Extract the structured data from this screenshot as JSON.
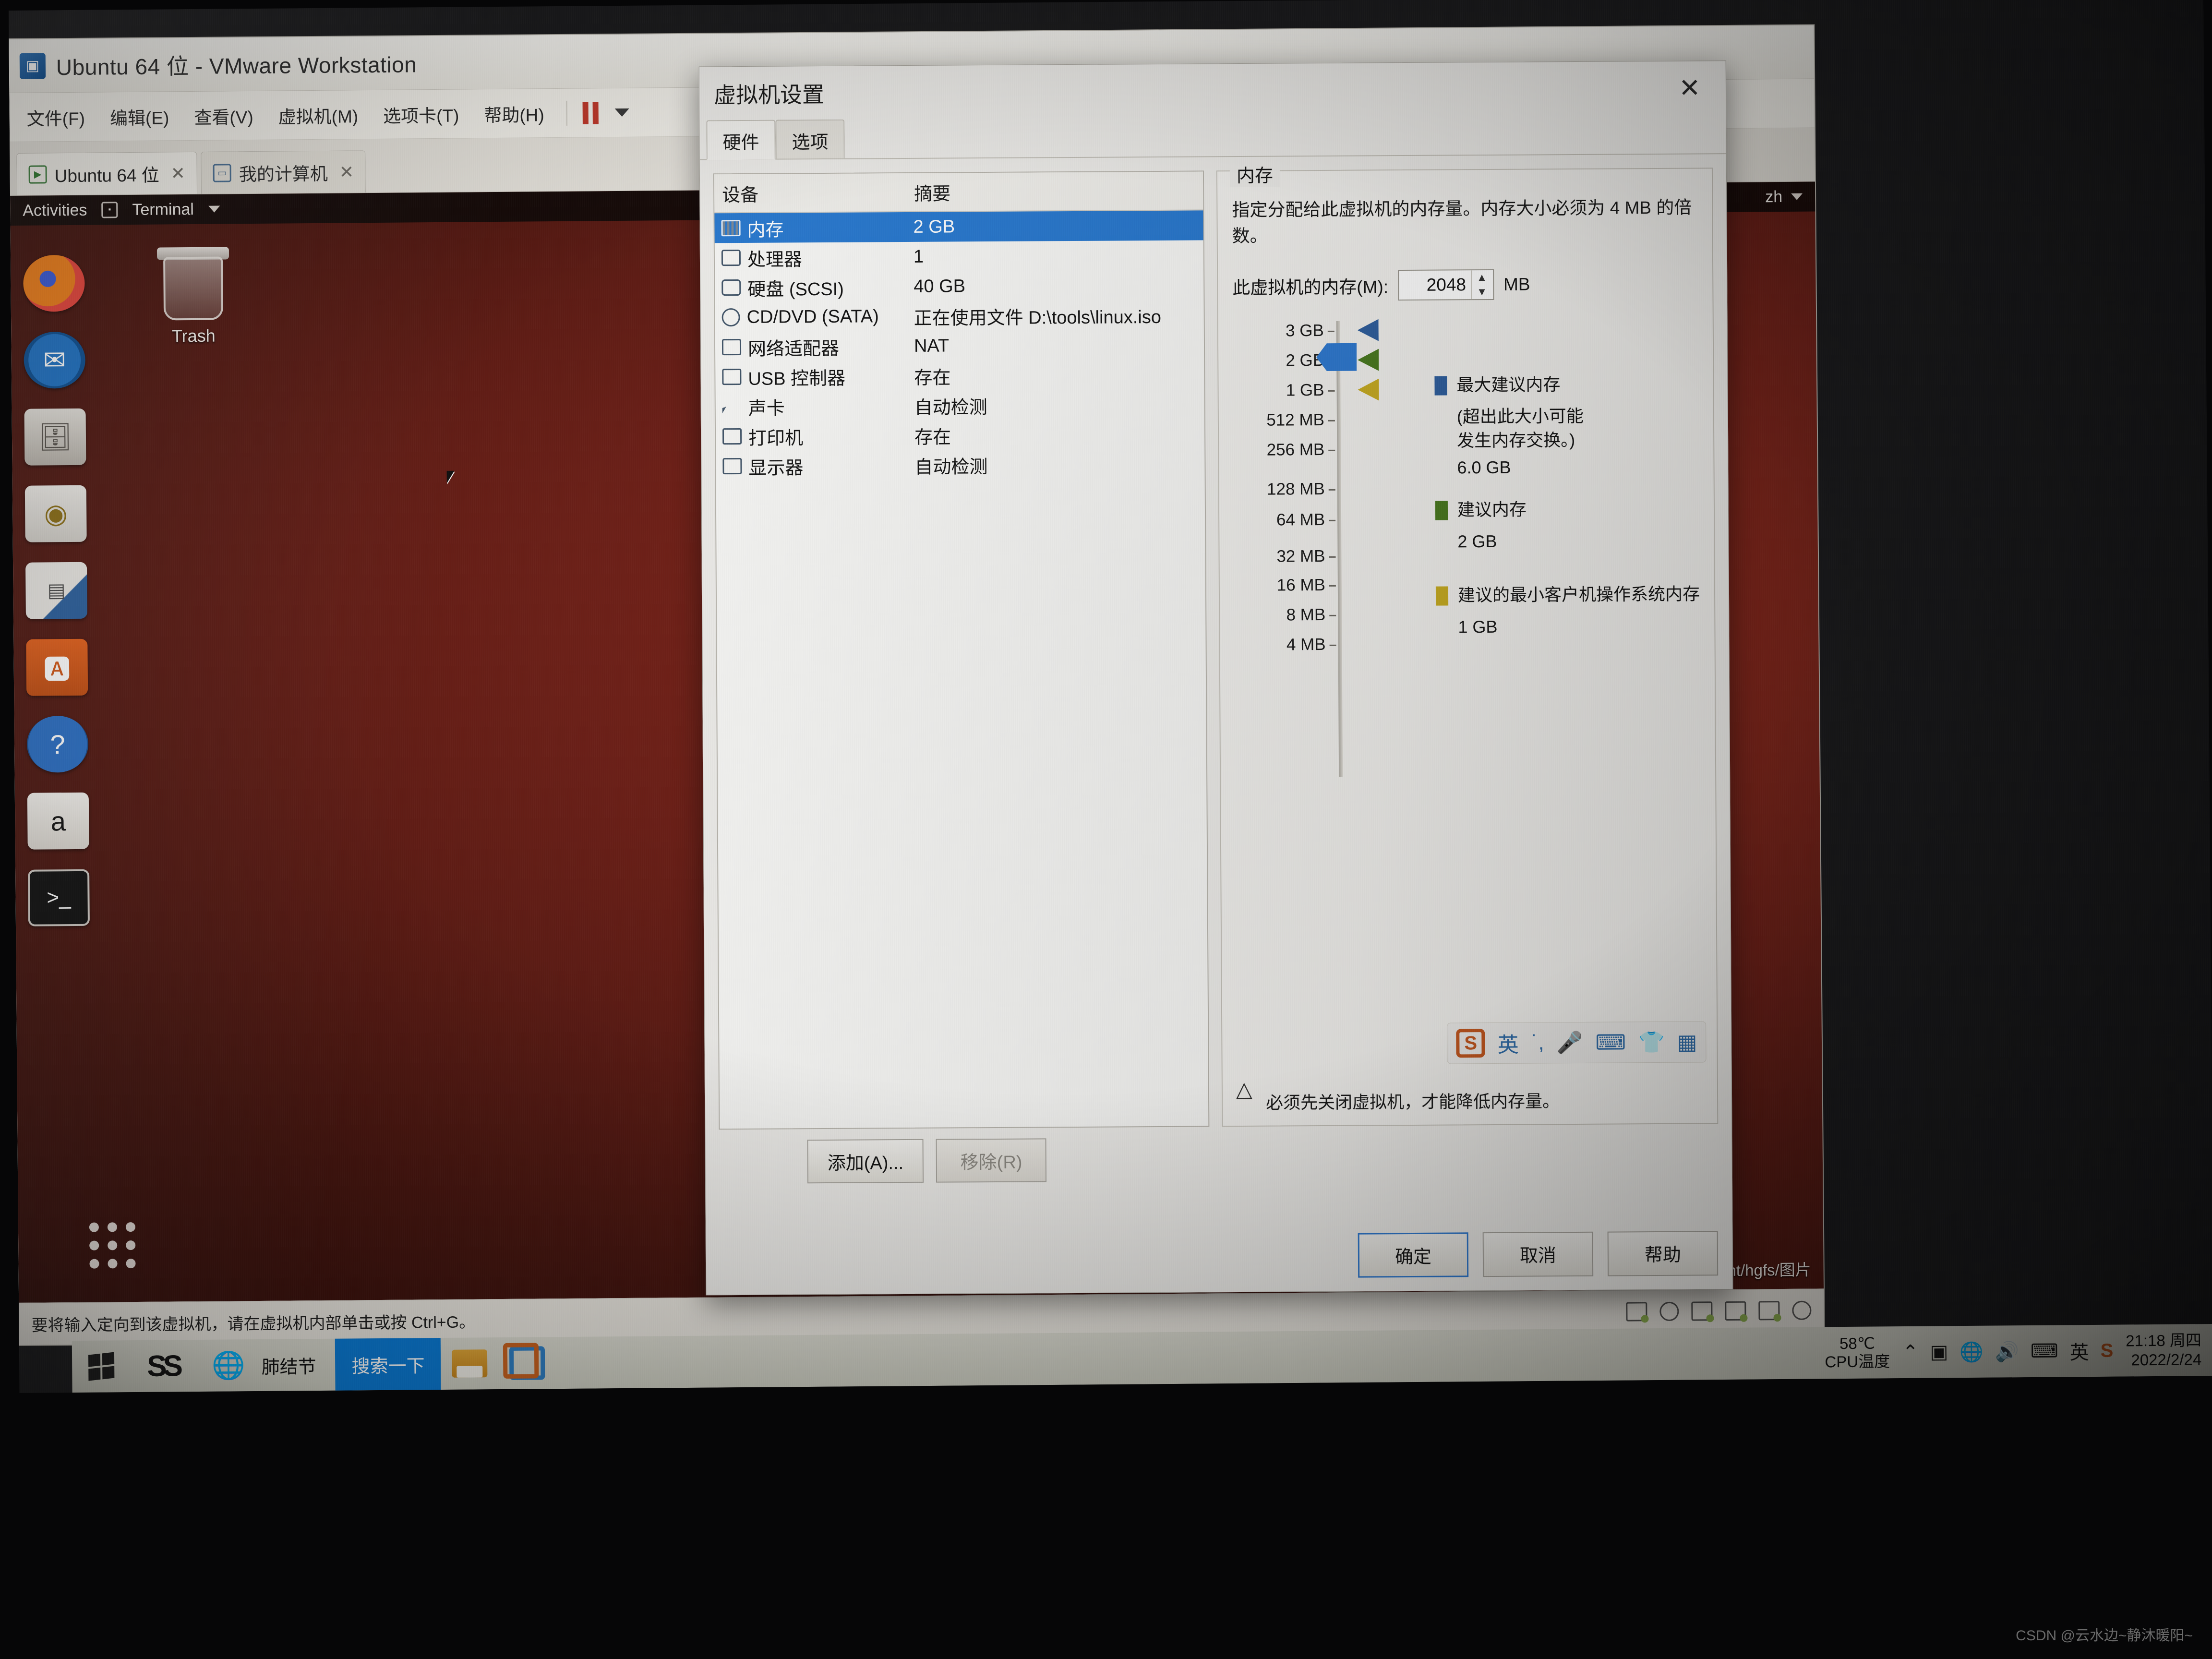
{
  "vmware": {
    "window_title": "Ubuntu 64 位 - VMware Workstation",
    "menu": [
      "文件(F)",
      "编辑(E)",
      "查看(V)",
      "虚拟机(M)",
      "选项卡(T)",
      "帮助(H)"
    ],
    "tabs": [
      {
        "label": "Ubuntu 64 位",
        "close": "✕"
      },
      {
        "label": "我的计算机",
        "close": "✕"
      }
    ],
    "status_text": "要将输入定向到该虚拟机，请在虚拟机内部单击或按 Ctrl+G。"
  },
  "guest": {
    "activities": "Activities",
    "app_menu": "Terminal",
    "lang": "zh",
    "desktop_icon": "Trash",
    "nautilus_path": "nux-virtual-machine: /mnt/hgfs/图片",
    "dock": [
      {
        "name": "firefox",
        "glyph": "🦊"
      },
      {
        "name": "thunderbird",
        "glyph": "✉"
      },
      {
        "name": "files",
        "glyph": "🗄"
      },
      {
        "name": "rhythmbox",
        "glyph": "◉"
      },
      {
        "name": "libreoffice-writer",
        "glyph": "📄"
      },
      {
        "name": "ubuntu-software",
        "glyph": "🅰"
      },
      {
        "name": "help",
        "glyph": "?"
      },
      {
        "name": "amazon",
        "glyph": "a"
      },
      {
        "name": "terminal",
        "glyph": ">_"
      }
    ]
  },
  "dialog": {
    "title": "虚拟机设置",
    "close": "✕",
    "tabs": [
      {
        "label": "硬件",
        "active": true
      },
      {
        "label": "选项",
        "active": false
      }
    ],
    "device_table": {
      "headers": [
        "设备",
        "摘要"
      ],
      "rows": [
        {
          "device": "内存",
          "summary": "2 GB",
          "icon": "memory-icon",
          "selected": true
        },
        {
          "device": "处理器",
          "summary": "1",
          "icon": "cpu-icon",
          "selected": false
        },
        {
          "device": "硬盘 (SCSI)",
          "summary": "40 GB",
          "icon": "harddisk-icon",
          "selected": false
        },
        {
          "device": "CD/DVD (SATA)",
          "summary": "正在使用文件 D:\\tools\\linux.iso",
          "icon": "cd-icon",
          "selected": false
        },
        {
          "device": "网络适配器",
          "summary": "NAT",
          "icon": "network-icon",
          "selected": false
        },
        {
          "device": "USB 控制器",
          "summary": "存在",
          "icon": "usb-icon",
          "selected": false
        },
        {
          "device": "声卡",
          "summary": "自动检测",
          "icon": "sound-icon",
          "selected": false
        },
        {
          "device": "打印机",
          "summary": "存在",
          "icon": "printer-icon",
          "selected": false
        },
        {
          "device": "显示器",
          "summary": "自动检测",
          "icon": "display-icon",
          "selected": false
        }
      ]
    },
    "add_button": "添加(A)...",
    "remove_button": "移除(R)",
    "ok_button": "确定",
    "cancel_button": "取消",
    "help_button": "帮助",
    "memory_panel": {
      "legend": "内存",
      "description": "指定分配给此虚拟机的内存量。内存大小必须为 4 MB 的倍数。",
      "field_label": "此虚拟机的内存(M):",
      "field_value": "2048",
      "field_unit": "MB",
      "warning": "必须先关闭虚拟机，才能降低内存量。",
      "scale_labels": [
        "3 GB",
        "2 GB",
        "1 GB",
        "512 MB",
        "256 MB",
        "128 MB",
        "64 MB",
        "32 MB",
        "16 MB",
        "8 MB",
        "4 MB"
      ],
      "slider_value_label": "2 GB",
      "markers": [
        {
          "name": "max-recommended",
          "color": "#2f5f9e",
          "label": "最大建议内存",
          "note": "(超出此大小可能\n发生内存交换。)",
          "value": "6.0 GB"
        },
        {
          "name": "recommended",
          "color": "#4a7a20",
          "label": "建议内存",
          "value": "2 GB"
        },
        {
          "name": "guest-os-minimum",
          "color": "#c8ac22",
          "label": "建议的最小客户机操作系统内存",
          "value": "1 GB"
        }
      ]
    },
    "ime": {
      "logo": "S",
      "mode": "英",
      "items": [
        "punctuation-icon",
        "microphone-icon",
        "keyboard-icon",
        "skin-icon",
        "toolbox-icon"
      ]
    }
  },
  "taskbar": {
    "start": "windows-start-icon",
    "sogou": "sogou-icon",
    "ie_label": "肺结节",
    "search_button": "搜索一下",
    "cpu_temp_value": "58℃",
    "cpu_temp_label": "CPU温度",
    "tray": [
      "chevron-up-icon",
      "monitor-icon",
      "network-icon",
      "volume-icon",
      "keyboard-icon",
      "ime-en-icon",
      "sogou-icon"
    ],
    "clock_time": "21:18 周四",
    "clock_date": "2022/2/24"
  },
  "watermark": "CSDN @云水边~静沐暖阳~"
}
